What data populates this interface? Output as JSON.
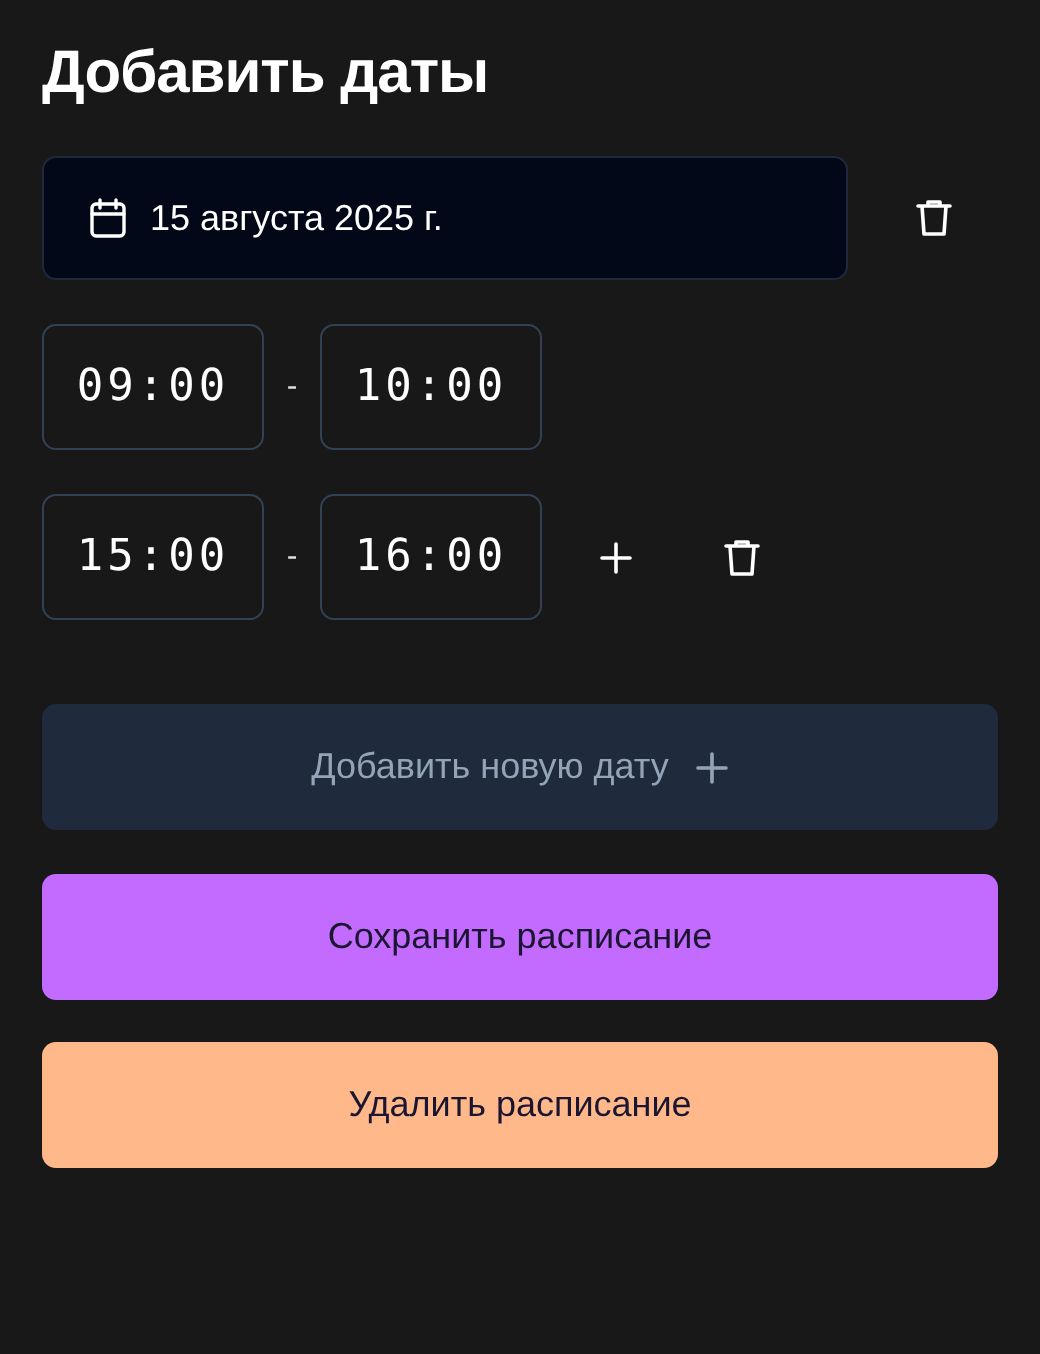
{
  "title": "Добавить даты",
  "dates": [
    {
      "date": "15 августа 2025 г.",
      "slots": [
        {
          "kind": "plain",
          "start": "09:00",
          "separator": "-",
          "end": "10:00"
        },
        {
          "kind": "editable",
          "start": "15:00",
          "separator": "-",
          "end": "16:00"
        }
      ]
    }
  ],
  "add_date_button": {
    "label": "Добавить новую дату"
  },
  "buttons": [
    {
      "kind": "save",
      "label": "Сохранить расписание"
    },
    {
      "kind": "delete",
      "label": "Удалить расписание"
    }
  ]
}
